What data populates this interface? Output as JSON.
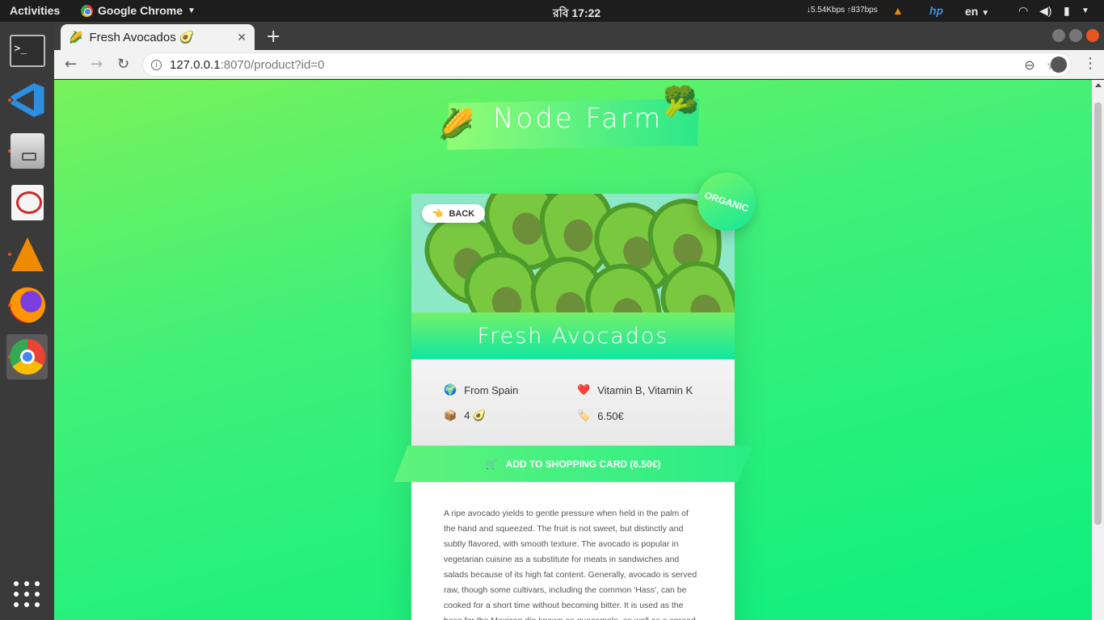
{
  "topbar": {
    "activities": "Activities",
    "app_menu": "Google Chrome",
    "clock": "রবি 17:22",
    "net": "↓5.54Kbps ↑837bps",
    "lang": "en"
  },
  "browser": {
    "tab_title": "Fresh Avocados 🥑",
    "tab_icon": "🌽",
    "url_host": "127.0.0.1",
    "url_path": ":8070/product?id=0"
  },
  "page": {
    "logo": "Node Farm",
    "logo_left_emoji": "🌽",
    "logo_right_emoji": "🥦",
    "back_label": "BACK",
    "back_emoji": "👈",
    "organic_label": "ORGANIC",
    "product_name": "Fresh Avocados",
    "from_emoji": "🌍",
    "from": "From Spain",
    "nutrients_emoji": "❤️",
    "nutrients": "Vitamin B, Vitamin K",
    "quantity_emoji": "📦",
    "quantity": "4 🥑",
    "price_emoji": "🏷️",
    "price": "6.50€",
    "cart_emoji": "🛒",
    "cart_label": "ADD TO SHOPPING CARD (6.50€)",
    "description": "A ripe avocado yields to gentle pressure when held in the palm of the hand and squeezed. The fruit is not sweet, but distinctly and subtly flavored, with smooth texture. The avocado is popular in vegetarian cuisine as a substitute for meats in sandwiches and salads because of its high fat content. Generally, avocado is served raw, though some cultivars, including the common 'Hass', can be cooked for a short time without becoming bitter. It is used as the base for the Mexican dip known as guacamole, as well as a spread on corn tortillas or toast, served with spices."
  },
  "colors": {
    "accent_green": "#3ef07a",
    "ubuntu_orange": "#e95420"
  }
}
